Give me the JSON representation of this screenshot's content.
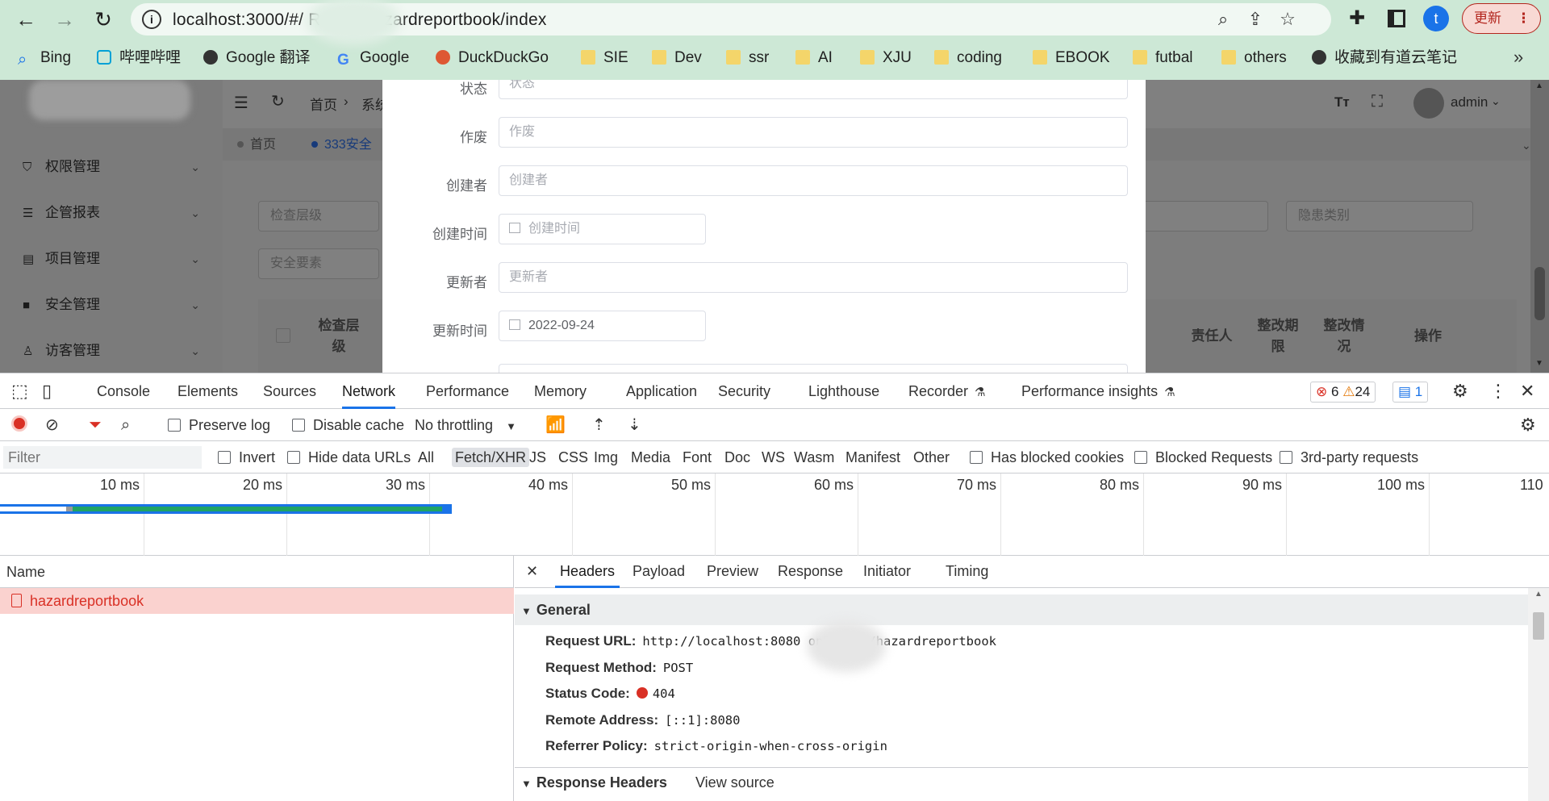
{
  "browser": {
    "url": "localhost:3000/#/       Report/hazardreportbook/index",
    "profile_initial": "t",
    "update_label": "更新",
    "bookmarks": [
      {
        "label": "Bing",
        "icon": "search-icon"
      },
      {
        "label": "哔哩哔哩",
        "icon": "bilibili-icon"
      },
      {
        "label": "Google 翻译",
        "icon": "globe-icon"
      },
      {
        "label": "Google",
        "icon": "google-icon"
      },
      {
        "label": "DuckDuckGo",
        "icon": "duckduckgo-icon"
      },
      {
        "label": "SIE",
        "icon": "folder-icon"
      },
      {
        "label": "Dev",
        "icon": "folder-icon"
      },
      {
        "label": "ssr",
        "icon": "folder-icon"
      },
      {
        "label": "AI",
        "icon": "folder-icon"
      },
      {
        "label": "XJU",
        "icon": "folder-icon"
      },
      {
        "label": "coding",
        "icon": "folder-icon"
      },
      {
        "label": "EBOOK",
        "icon": "folder-icon"
      },
      {
        "label": "futbal",
        "icon": "folder-icon"
      },
      {
        "label": "others",
        "icon": "folder-icon"
      },
      {
        "label": "收藏到有道云笔记",
        "icon": "globe-icon"
      }
    ]
  },
  "app": {
    "sidebar": [
      {
        "label": "权限管理",
        "icon": "shield-icon"
      },
      {
        "label": "企管报表",
        "icon": "list-icon"
      },
      {
        "label": "项目管理",
        "icon": "doc-icon"
      },
      {
        "label": "安全管理",
        "icon": "video-icon"
      },
      {
        "label": "访客管理",
        "icon": "user-icon"
      }
    ],
    "breadcrumb_home": "首页",
    "breadcrumb_next": "系统",
    "user": "admin",
    "tags": [
      {
        "label": "首页"
      },
      {
        "label": "333安全"
      }
    ],
    "filters": {
      "level": "检查层级",
      "element": "安全要素",
      "category": "隐患类别"
    },
    "table_headers": [
      "检查层级",
      "责任人",
      "整改期限",
      "整改情况",
      "操作"
    ]
  },
  "modal": {
    "fields": [
      {
        "label": "状态",
        "placeholder": "状态"
      },
      {
        "label": "作废",
        "placeholder": "作废"
      },
      {
        "label": "创建者",
        "placeholder": "创建者"
      },
      {
        "label": "创建时间",
        "placeholder": "创建时间"
      },
      {
        "label": "更新者",
        "placeholder": "更新者"
      },
      {
        "label": "更新时间",
        "value": "2022-09-24"
      }
    ]
  },
  "devtools": {
    "tabs": [
      "Console",
      "Elements",
      "Sources",
      "Network",
      "Performance",
      "Memory",
      "Application",
      "Security",
      "Lighthouse",
      "Recorder",
      "Performance insights"
    ],
    "active_tab": "Network",
    "errors": "6",
    "warnings": "24",
    "messages": "1",
    "toolbar": {
      "preserve_log": "Preserve log",
      "disable_cache": "Disable cache",
      "throttling": "No throttling"
    },
    "filter": {
      "placeholder": "Filter",
      "invert": "Invert",
      "hide_data_urls": "Hide data URLs",
      "types": [
        "All",
        "Fetch/XHR",
        "JS",
        "CSS",
        "Img",
        "Media",
        "Font",
        "Doc",
        "WS",
        "Wasm",
        "Manifest",
        "Other"
      ],
      "active_type": "Fetch/XHR",
      "has_blocked_cookies": "Has blocked cookies",
      "blocked_requests": "Blocked Requests",
      "third_party": "3rd-party requests"
    },
    "timeline_ticks": [
      "10 ms",
      "20 ms",
      "30 ms",
      "40 ms",
      "50 ms",
      "60 ms",
      "70 ms",
      "80 ms",
      "90 ms",
      "100 ms",
      "110"
    ],
    "request_list": {
      "header": "Name",
      "requests": [
        {
          "name": "hazardreportbook",
          "status": "error"
        }
      ]
    },
    "detail_tabs": [
      "Headers",
      "Payload",
      "Preview",
      "Response",
      "Initiator",
      "Timing"
    ],
    "active_detail_tab": "Headers",
    "general": {
      "title": "General",
      "rows": [
        {
          "key": "Request URL:",
          "value": "http://localhost:8080        onReport/hazardreportbook"
        },
        {
          "key": "Request Method:",
          "value": "POST"
        },
        {
          "key": "Status Code:",
          "value": "404"
        },
        {
          "key": "Remote Address:",
          "value": "[::1]:8080"
        },
        {
          "key": "Referrer Policy:",
          "value": "strict-origin-when-cross-origin"
        }
      ]
    },
    "response_headers": {
      "title": "Response Headers",
      "view_source": "View source"
    }
  }
}
